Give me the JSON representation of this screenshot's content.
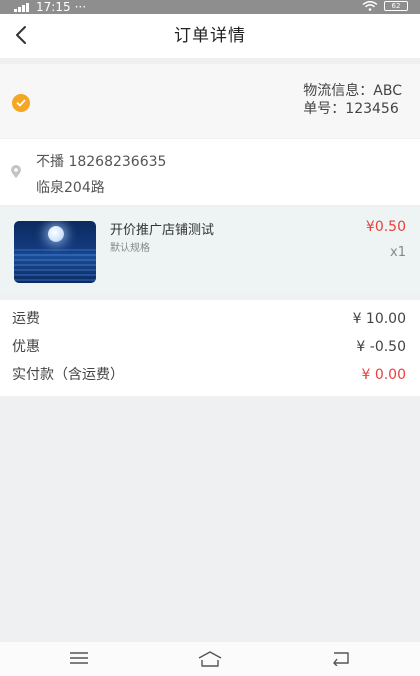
{
  "status_bar": {
    "time": "17:15",
    "dots": "···",
    "battery": "62"
  },
  "header": {
    "title": "订单详情"
  },
  "logistics": {
    "info": "物流信息：ABC",
    "number": "单号：123456"
  },
  "address": {
    "name_phone": "不播 18268236635",
    "street": "临泉204路"
  },
  "product": {
    "name": "开价推广店铺测试",
    "spec": "默认规格",
    "price": "¥0.50",
    "quantity": "x1"
  },
  "fees": [
    {
      "label": "运费",
      "value": "¥ 10.00",
      "highlight": false
    },
    {
      "label": "优惠",
      "value": "¥ -0.50",
      "highlight": false
    },
    {
      "label": "实付款（含运费）",
      "value": "¥ 0.00",
      "highlight": true
    }
  ],
  "colors": {
    "accent": "#f5a623",
    "price_red": "#e8413f"
  }
}
